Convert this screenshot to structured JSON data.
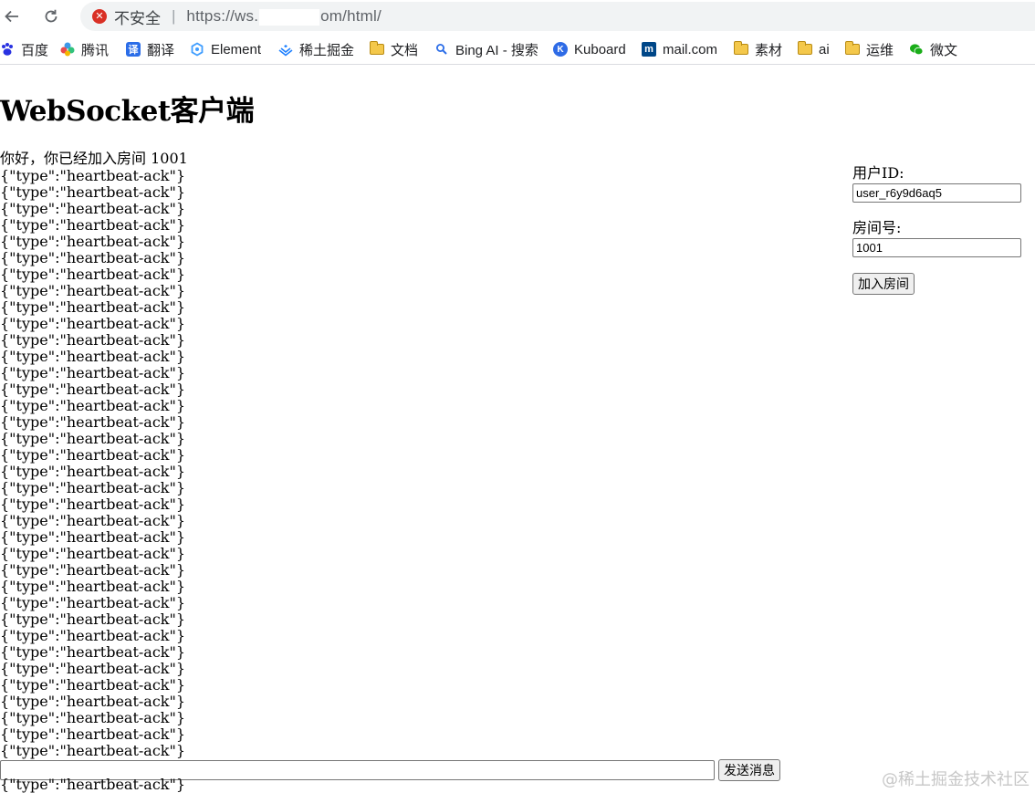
{
  "browser": {
    "security_label": "不安全",
    "url_prefix": "https://ws.",
    "url_suffix": "om/html/"
  },
  "bookmarks": [
    {
      "label": "百度",
      "icon": "baidu-paw-icon"
    },
    {
      "label": "腾讯",
      "icon": "tencent-flower-icon"
    },
    {
      "label": "翻译",
      "icon": "translate-icon"
    },
    {
      "label": "Element",
      "icon": "element-icon"
    },
    {
      "label": "稀土掘金",
      "icon": "juejin-icon"
    },
    {
      "label": "文档",
      "icon": "folder-icon"
    },
    {
      "label": "Bing AI - 搜索",
      "icon": "search-icon"
    },
    {
      "label": "Kuboard",
      "icon": "kuboard-icon"
    },
    {
      "label": "mail.com",
      "icon": "mail-icon"
    },
    {
      "label": "素材",
      "icon": "folder-icon"
    },
    {
      "label": "ai",
      "icon": "folder-icon"
    },
    {
      "label": "运维",
      "icon": "folder-icon"
    },
    {
      "label": "微文",
      "icon": "wechat-icon"
    }
  ],
  "page": {
    "title": "WebSocket客户端",
    "greeting": "你好，你已经加入房间 1001",
    "messages": [
      "{\"type\":\"heartbeat-ack\"}",
      "{\"type\":\"heartbeat-ack\"}",
      "{\"type\":\"heartbeat-ack\"}",
      "{\"type\":\"heartbeat-ack\"}",
      "{\"type\":\"heartbeat-ack\"}",
      "{\"type\":\"heartbeat-ack\"}",
      "{\"type\":\"heartbeat-ack\"}",
      "{\"type\":\"heartbeat-ack\"}",
      "{\"type\":\"heartbeat-ack\"}",
      "{\"type\":\"heartbeat-ack\"}",
      "{\"type\":\"heartbeat-ack\"}",
      "{\"type\":\"heartbeat-ack\"}",
      "{\"type\":\"heartbeat-ack\"}",
      "{\"type\":\"heartbeat-ack\"}",
      "{\"type\":\"heartbeat-ack\"}",
      "{\"type\":\"heartbeat-ack\"}",
      "{\"type\":\"heartbeat-ack\"}",
      "{\"type\":\"heartbeat-ack\"}",
      "{\"type\":\"heartbeat-ack\"}",
      "{\"type\":\"heartbeat-ack\"}",
      "{\"type\":\"heartbeat-ack\"}",
      "{\"type\":\"heartbeat-ack\"}",
      "{\"type\":\"heartbeat-ack\"}",
      "{\"type\":\"heartbeat-ack\"}",
      "{\"type\":\"heartbeat-ack\"}",
      "{\"type\":\"heartbeat-ack\"}",
      "{\"type\":\"heartbeat-ack\"}",
      "{\"type\":\"heartbeat-ack\"}",
      "{\"type\":\"heartbeat-ack\"}",
      "{\"type\":\"heartbeat-ack\"}",
      "{\"type\":\"heartbeat-ack\"}",
      "{\"type\":\"heartbeat-ack\"}",
      "{\"type\":\"heartbeat-ack\"}",
      "{\"type\":\"heartbeat-ack\"}",
      "{\"type\":\"heartbeat-ack\"}",
      "{\"type\":\"heartbeat-ack\"}"
    ],
    "message_input_value": "",
    "send_button": "发送消息",
    "last_message": "{\"type\":\"heartbeat-ack\"}"
  },
  "form": {
    "user_id_label": "用户ID:",
    "user_id_value": "user_r6y9d6aq5",
    "room_label": "房间号:",
    "room_value": "1001",
    "join_button": "加入房间"
  },
  "watermark": "@稀土掘金技术社区",
  "colors": {
    "insecure_red": "#d93025",
    "folder_yellow": "#f4c84b",
    "omnibox_bg": "#f1f3f4"
  }
}
